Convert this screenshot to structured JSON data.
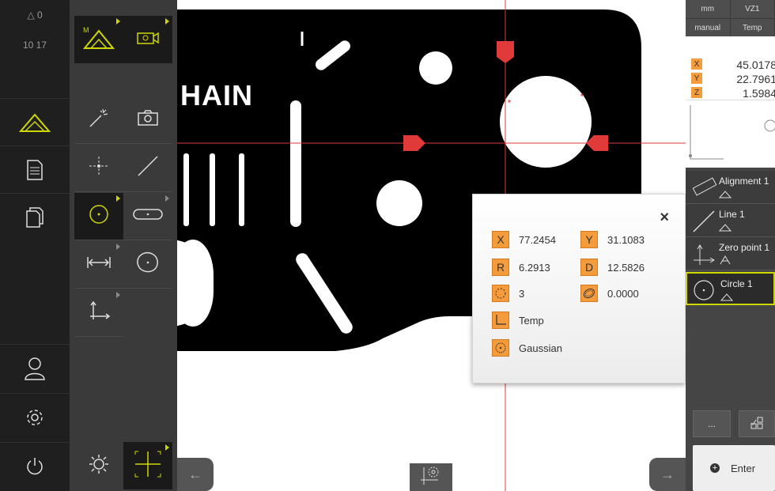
{
  "status": {
    "delta_label": "△ 0",
    "time": "10 17"
  },
  "units": {
    "length": "mm",
    "vz": "VZ1",
    "mode": "manual",
    "coord": "Temp"
  },
  "position": [
    {
      "axis": "X",
      "value": "45.0178"
    },
    {
      "axis": "Y",
      "value": "22.7961"
    },
    {
      "axis": "Z",
      "value": "1.5984"
    }
  ],
  "features": [
    {
      "name": "Alignment 1"
    },
    {
      "name": "Line 1"
    },
    {
      "name": "Zero point 1"
    },
    {
      "name": "Circle 1"
    }
  ],
  "canvas_text": "HAIN",
  "popup": {
    "close": "×",
    "x_tag": "X",
    "x_val": "77.2454",
    "y_tag": "Y",
    "y_val": "31.1083",
    "r_tag": "R",
    "r_val": "6.2913",
    "d_tag": "D",
    "d_val": "12.5826",
    "points_val": "3",
    "form_val": "0.0000",
    "coord_val": "Temp",
    "filter_val": "Gaussian"
  },
  "buttons": {
    "more": "...",
    "enter": "Enter"
  },
  "colors": {
    "accent": "#cfd700",
    "tag": "#f49b3c",
    "marker": "#e03a3a",
    "crosshair": "#e03a3a"
  }
}
